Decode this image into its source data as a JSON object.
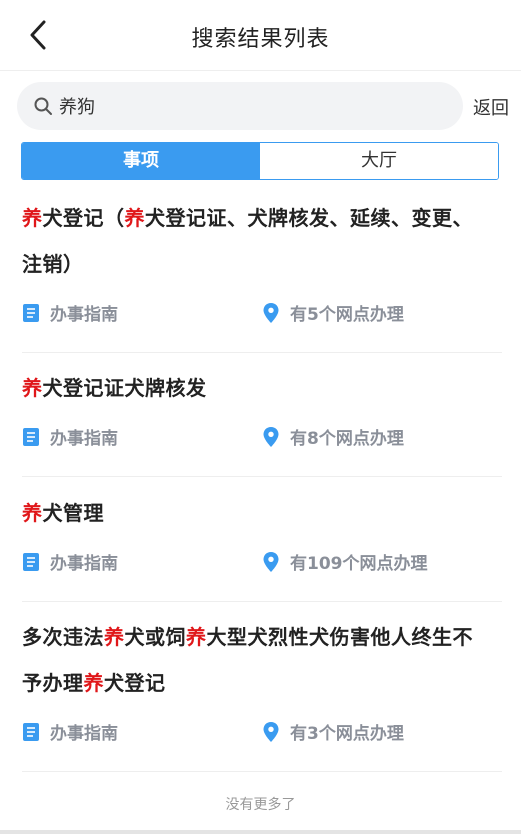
{
  "header": {
    "title": "搜索结果列表"
  },
  "search": {
    "value": "养狗",
    "back_label": "返回"
  },
  "tabs": [
    {
      "label": "事项",
      "active": true
    },
    {
      "label": "大厅",
      "active": false
    }
  ],
  "results": [
    {
      "title_line1": [
        {
          "t": "养",
          "hl": true
        },
        {
          "t": "犬登记（",
          "hl": false
        },
        {
          "t": "养",
          "hl": true
        },
        {
          "t": "犬登记证、犬牌核发、延续、变更、",
          "hl": false
        }
      ],
      "title_line2": [
        {
          "t": "注销）",
          "hl": false
        }
      ],
      "guide_label": "办事指南",
      "outlets_label": "有5个网点办理"
    },
    {
      "title_line1": [
        {
          "t": "养",
          "hl": true
        },
        {
          "t": "犬登记证犬牌核发",
          "hl": false
        }
      ],
      "guide_label": "办事指南",
      "outlets_label": "有8个网点办理"
    },
    {
      "title_line1": [
        {
          "t": "养",
          "hl": true
        },
        {
          "t": "犬管理",
          "hl": false
        }
      ],
      "guide_label": "办事指南",
      "outlets_label": "有109个网点办理"
    },
    {
      "title_line1": [
        {
          "t": "多次违法",
          "hl": false
        },
        {
          "t": "养",
          "hl": true
        },
        {
          "t": "犬或饲",
          "hl": false
        },
        {
          "t": "养",
          "hl": true
        },
        {
          "t": "大型犬烈性犬伤害他人终生不",
          "hl": false
        }
      ],
      "title_line2": [
        {
          "t": "予办理",
          "hl": false
        },
        {
          "t": "养",
          "hl": true
        },
        {
          "t": "犬登记",
          "hl": false
        }
      ],
      "guide_label": "办事指南",
      "outlets_label": "有3个网点办理"
    }
  ],
  "footer": {
    "no_more": "没有更多了"
  },
  "colors": {
    "accent": "#3a9bf0",
    "highlight": "#e0171a",
    "muted": "#8a8f99"
  },
  "icons": {
    "back": "chevron-left-icon",
    "search": "search-icon",
    "guide": "document-icon",
    "location": "location-pin-icon"
  }
}
